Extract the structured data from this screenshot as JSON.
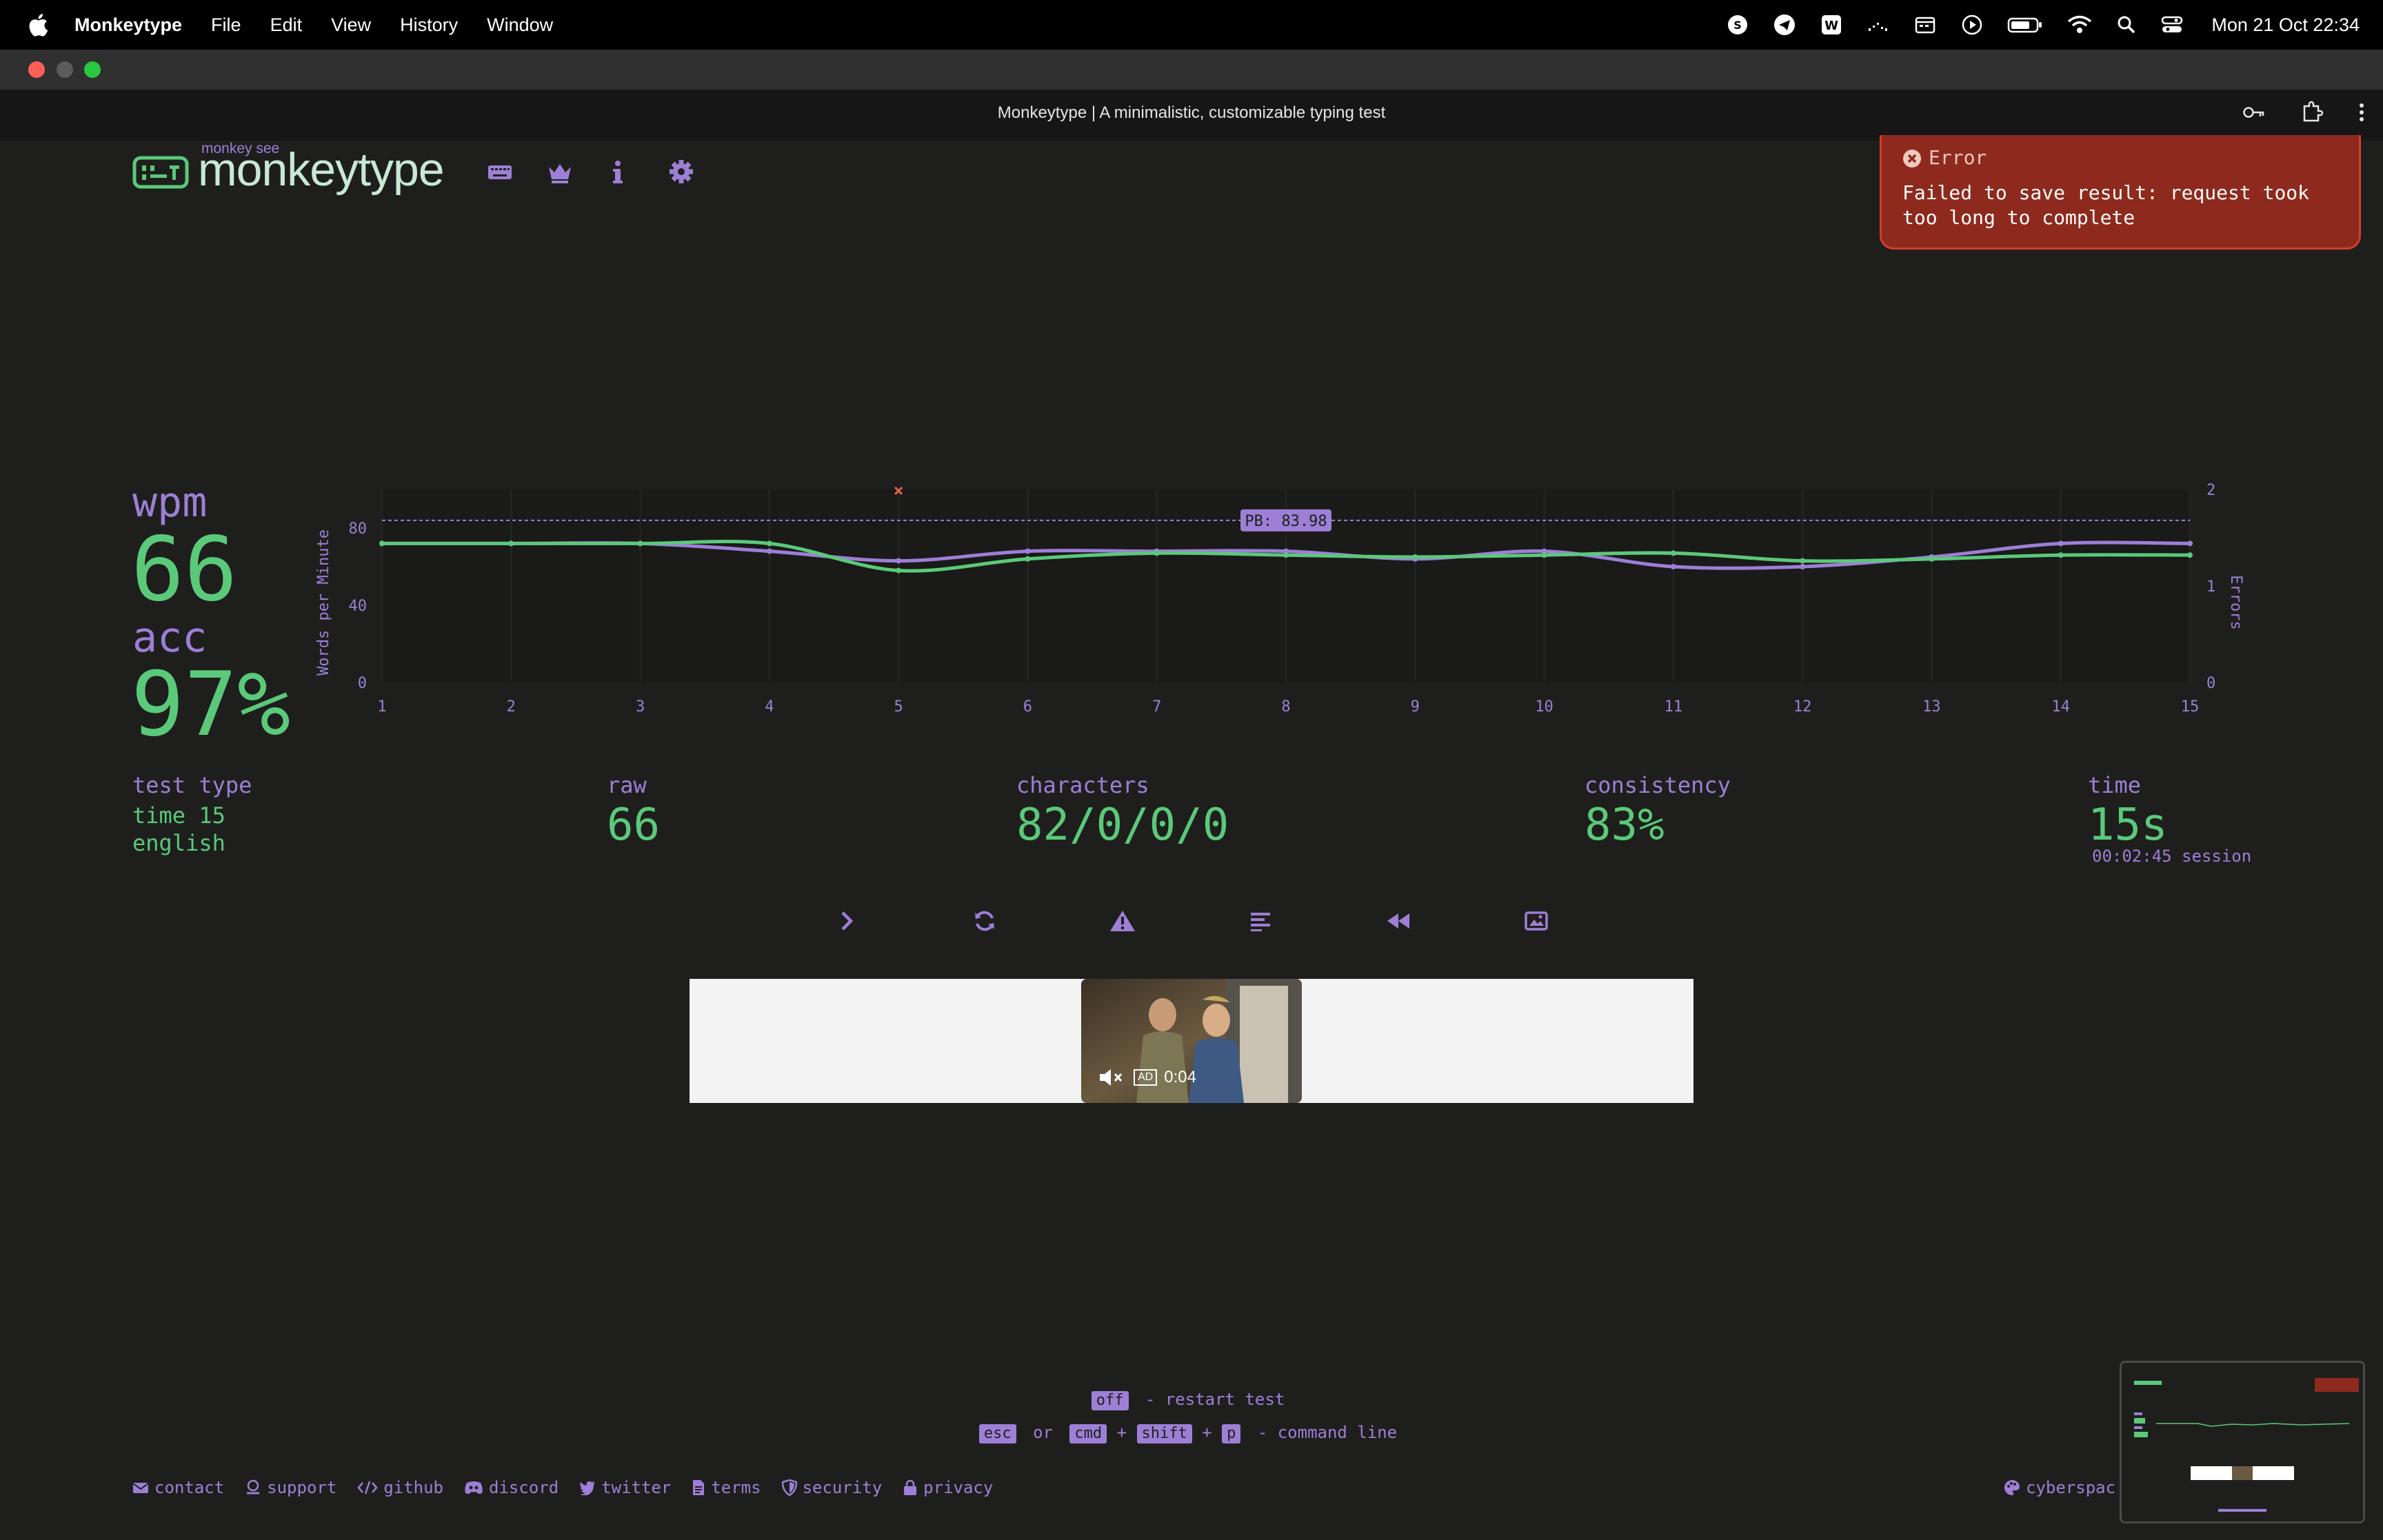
{
  "menubar": {
    "app_name": "Monkeytype",
    "items": [
      "File",
      "Edit",
      "View",
      "History",
      "Window"
    ],
    "clock": "Mon 21 Oct 22:34",
    "status_icons": [
      "onyx-icon",
      "telegram-icon",
      "word-icon",
      "waveform-icon",
      "calendar-icon",
      "play-icon",
      "battery-icon",
      "wifi-icon",
      "spotlight-icon",
      "control-center-icon"
    ]
  },
  "browser": {
    "page_title": "Monkeytype | A minimalistic, customizable typing test"
  },
  "header": {
    "logo_sub": "monkey see",
    "logo_text": "monkeytype",
    "nav_icons": [
      "keyboard-icon",
      "crown-icon",
      "info-icon",
      "gear-icon"
    ]
  },
  "toast": {
    "title": "Error",
    "message": "Failed to save result: request took too long to complete"
  },
  "result": {
    "wpm_label": "wpm",
    "wpm": "66",
    "acc_label": "acc",
    "acc": "97%",
    "test_type_label": "test type",
    "test_type_line1": "time 15",
    "test_type_line2": "english",
    "raw_label": "raw",
    "raw": "66",
    "characters_label": "characters",
    "characters": "82/0/0/0",
    "consistency_label": "consistency",
    "consistency": "83%",
    "time_label": "time",
    "time": "15s",
    "session": "00:02:45 session"
  },
  "chart_data": {
    "type": "line",
    "x": [
      1,
      2,
      3,
      4,
      5,
      6,
      7,
      8,
      9,
      10,
      11,
      12,
      13,
      14,
      15
    ],
    "series": [
      {
        "name": "wpm",
        "color": "#5bc97a",
        "values": [
          72,
          72,
          72,
          72,
          58,
          64,
          67,
          66,
          65,
          66,
          67,
          63,
          64,
          66,
          66
        ]
      },
      {
        "name": "raw",
        "color": "#9d7fd6",
        "values": [
          72,
          72,
          72,
          68,
          63,
          68,
          68,
          68,
          64,
          68,
          60,
          60,
          65,
          72,
          72
        ]
      }
    ],
    "errors": [
      {
        "x": 5,
        "value": 1
      }
    ],
    "pb_value": 83.98,
    "pb_label": "PB: 83.98",
    "ylabel": "Words per Minute",
    "y2label": "Errors",
    "ylim": [
      0,
      100
    ],
    "y2lim": [
      0,
      2
    ],
    "yticks": [
      0,
      40,
      80
    ],
    "y2ticks": [
      0,
      1,
      2
    ]
  },
  "actions": [
    "next-test-icon",
    "restart-icon",
    "warning-icon",
    "words-history-icon",
    "replay-icon",
    "screenshot-icon"
  ],
  "ad": {
    "badge": "AD",
    "time": "0:04"
  },
  "hints": {
    "line1_key": "off",
    "line1_text": "- restart test",
    "line2_key1": "esc",
    "line2_or": "or",
    "line2_key2": "cmd",
    "line2_plus1": "+",
    "line2_key3": "shift",
    "line2_plus2": "+",
    "line2_key4": "p",
    "line2_text": "- command line"
  },
  "footer": {
    "links": [
      "contact",
      "support",
      "github",
      "discord",
      "twitter",
      "terms",
      "security",
      "privacy"
    ],
    "theme": "cyberspac"
  },
  "colors": {
    "accent": "#9d7fd6",
    "value": "#5bc97a",
    "background": "#1e1f1d",
    "error": "#8e2a1d"
  }
}
